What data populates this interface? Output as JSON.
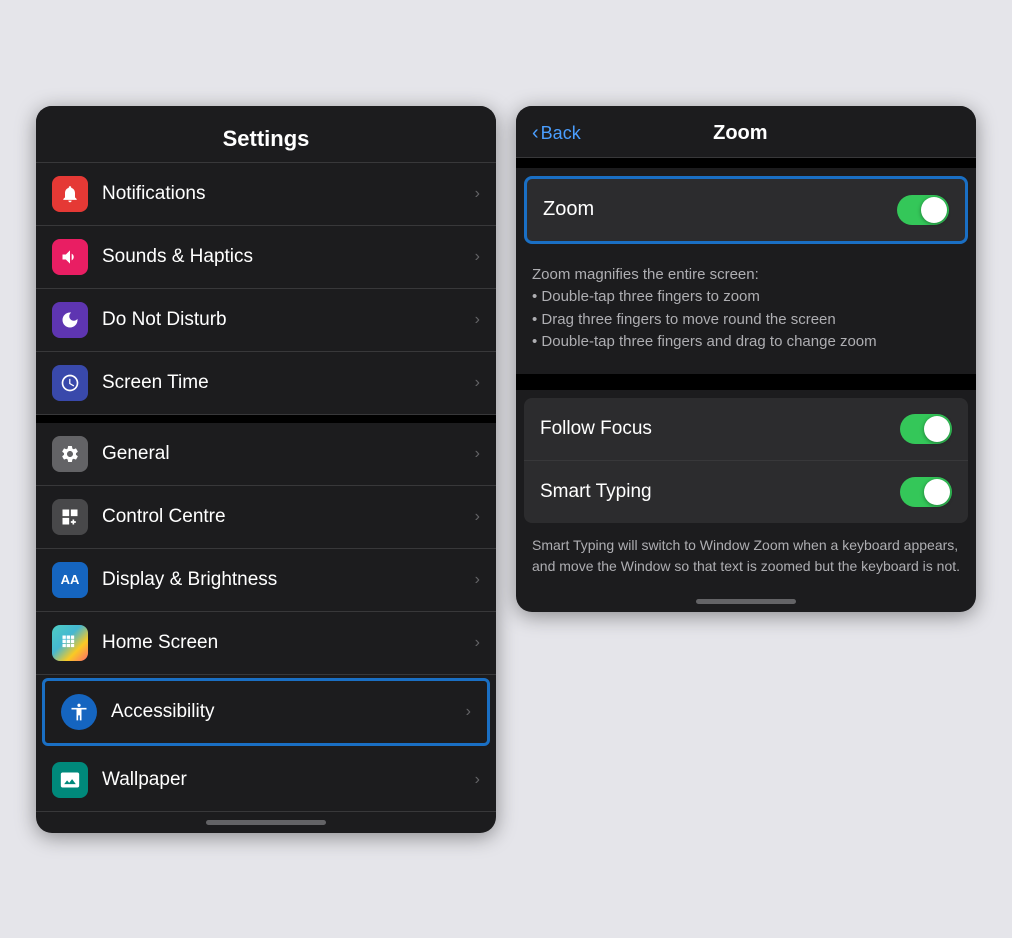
{
  "settings": {
    "title": "Settings",
    "items": [
      {
        "id": "notifications",
        "label": "Notifications",
        "icon": "🔔",
        "iconClass": "icon-red",
        "chevron": "›",
        "separator": false
      },
      {
        "id": "sounds-haptics",
        "label": "Sounds & Haptics",
        "icon": "🔊",
        "iconClass": "icon-pink",
        "chevron": "›",
        "separator": false
      },
      {
        "id": "do-not-disturb",
        "label": "Do Not Disturb",
        "icon": "🌙",
        "iconClass": "icon-purple",
        "chevron": "›",
        "separator": false
      },
      {
        "id": "screen-time",
        "label": "Screen Time",
        "icon": "⏳",
        "iconClass": "icon-indigo",
        "chevron": "›",
        "separator": false
      },
      {
        "id": "general",
        "label": "General",
        "icon": "⚙️",
        "iconClass": "icon-gray",
        "chevron": "›",
        "separator": true
      },
      {
        "id": "control-centre",
        "label": "Control Centre",
        "icon": "⊞",
        "iconClass": "icon-dark-gray",
        "chevron": "›",
        "separator": false
      },
      {
        "id": "display-brightness",
        "label": "Display & Brightness",
        "icon": "AA",
        "iconClass": "icon-blue",
        "chevron": "›",
        "separator": false
      },
      {
        "id": "home-screen",
        "label": "Home Screen",
        "icon": "⠿",
        "iconClass": "icon-multicolor",
        "chevron": "›",
        "separator": false
      },
      {
        "id": "accessibility",
        "label": "Accessibility",
        "icon": "♿",
        "iconClass": "icon-blue",
        "chevron": "›",
        "separator": false,
        "highlighted": true
      },
      {
        "id": "wallpaper",
        "label": "Wallpaper",
        "icon": "❋",
        "iconClass": "icon-teal",
        "chevron": "›",
        "separator": false
      }
    ],
    "scroll_indicator": ""
  },
  "zoom": {
    "back_label": "Back",
    "title": "Zoom",
    "zoom_toggle": {
      "label": "Zoom",
      "enabled": true
    },
    "description": "Zoom magnifies the entire screen:\n• Double-tap three fingers to zoom\n• Drag three fingers to move round the screen\n• Double-tap three fingers and drag to change zoom",
    "rows": [
      {
        "id": "follow-focus",
        "label": "Follow Focus",
        "toggle_enabled": true
      },
      {
        "id": "smart-typing",
        "label": "Smart Typing",
        "toggle_enabled": true
      }
    ],
    "footer_text": "Smart Typing will switch to Window Zoom when a keyboard appears, and move the Window so that text is zoomed but the keyboard is not.",
    "scroll_indicator": ""
  }
}
